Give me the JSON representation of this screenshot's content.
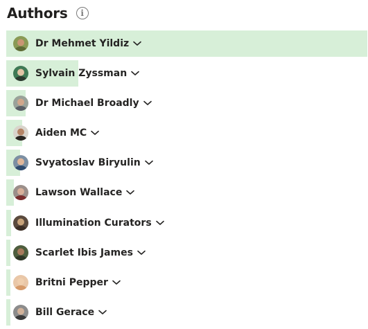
{
  "panel": {
    "title": "Authors",
    "info_icon": "info-icon"
  },
  "authors": [
    {
      "name": "Dr Mehmet Yildiz",
      "bar_fraction": 1.0,
      "avatar": {
        "bg": "#8a9a55",
        "skin": "#c99574",
        "shirt": "#5e6b36"
      }
    },
    {
      "name": "Sylvain Zyssman",
      "bar_fraction": 0.2,
      "avatar": {
        "bg": "#3f7a55",
        "skin": "#e2c4a6",
        "shirt": "#2c3a2f"
      }
    },
    {
      "name": "Dr Michael Broadly",
      "bar_fraction": 0.053,
      "avatar": {
        "bg": "#9aa29a",
        "skin": "#d1a78c",
        "shirt": "#5a5f66"
      }
    },
    {
      "name": "Aiden MC",
      "bar_fraction": 0.045,
      "avatar": {
        "bg": "#d9d4cc",
        "skin": "#b58466",
        "shirt": "#2a2622"
      }
    },
    {
      "name": "Svyatoslav Biryulin",
      "bar_fraction": 0.038,
      "avatar": {
        "bg": "#7c8fa3",
        "skin": "#e0b79a",
        "shirt": "#2f4b6e"
      }
    },
    {
      "name": "Lawson Wallace",
      "bar_fraction": 0.021,
      "avatar": {
        "bg": "#9b8f8a",
        "skin": "#d8b09a",
        "shirt": "#7a2d2d"
      }
    },
    {
      "name": "Illumination Curators",
      "bar_fraction": 0.014,
      "avatar": {
        "bg": "#5a4a3d",
        "skin": "#c8a37a",
        "shirt": "#3b2d24"
      }
    },
    {
      "name": "Scarlet Ibis James",
      "bar_fraction": 0.012,
      "avatar": {
        "bg": "#4e5e3e",
        "skin": "#a87a5c",
        "shirt": "#2e3626"
      }
    },
    {
      "name": "Britni Pepper",
      "bar_fraction": 0.01,
      "avatar": {
        "bg": "#e9c7a8",
        "skin": "#f0cfae",
        "shirt": "#d69a6a"
      }
    },
    {
      "name": "Bill Gerace",
      "bar_fraction": 0.008,
      "avatar": {
        "bg": "#8c8c8c",
        "skin": "#d2b29a",
        "shirt": "#3a3a3a"
      }
    }
  ],
  "colors": {
    "bar": "#d7efd8",
    "text": "#252423"
  }
}
